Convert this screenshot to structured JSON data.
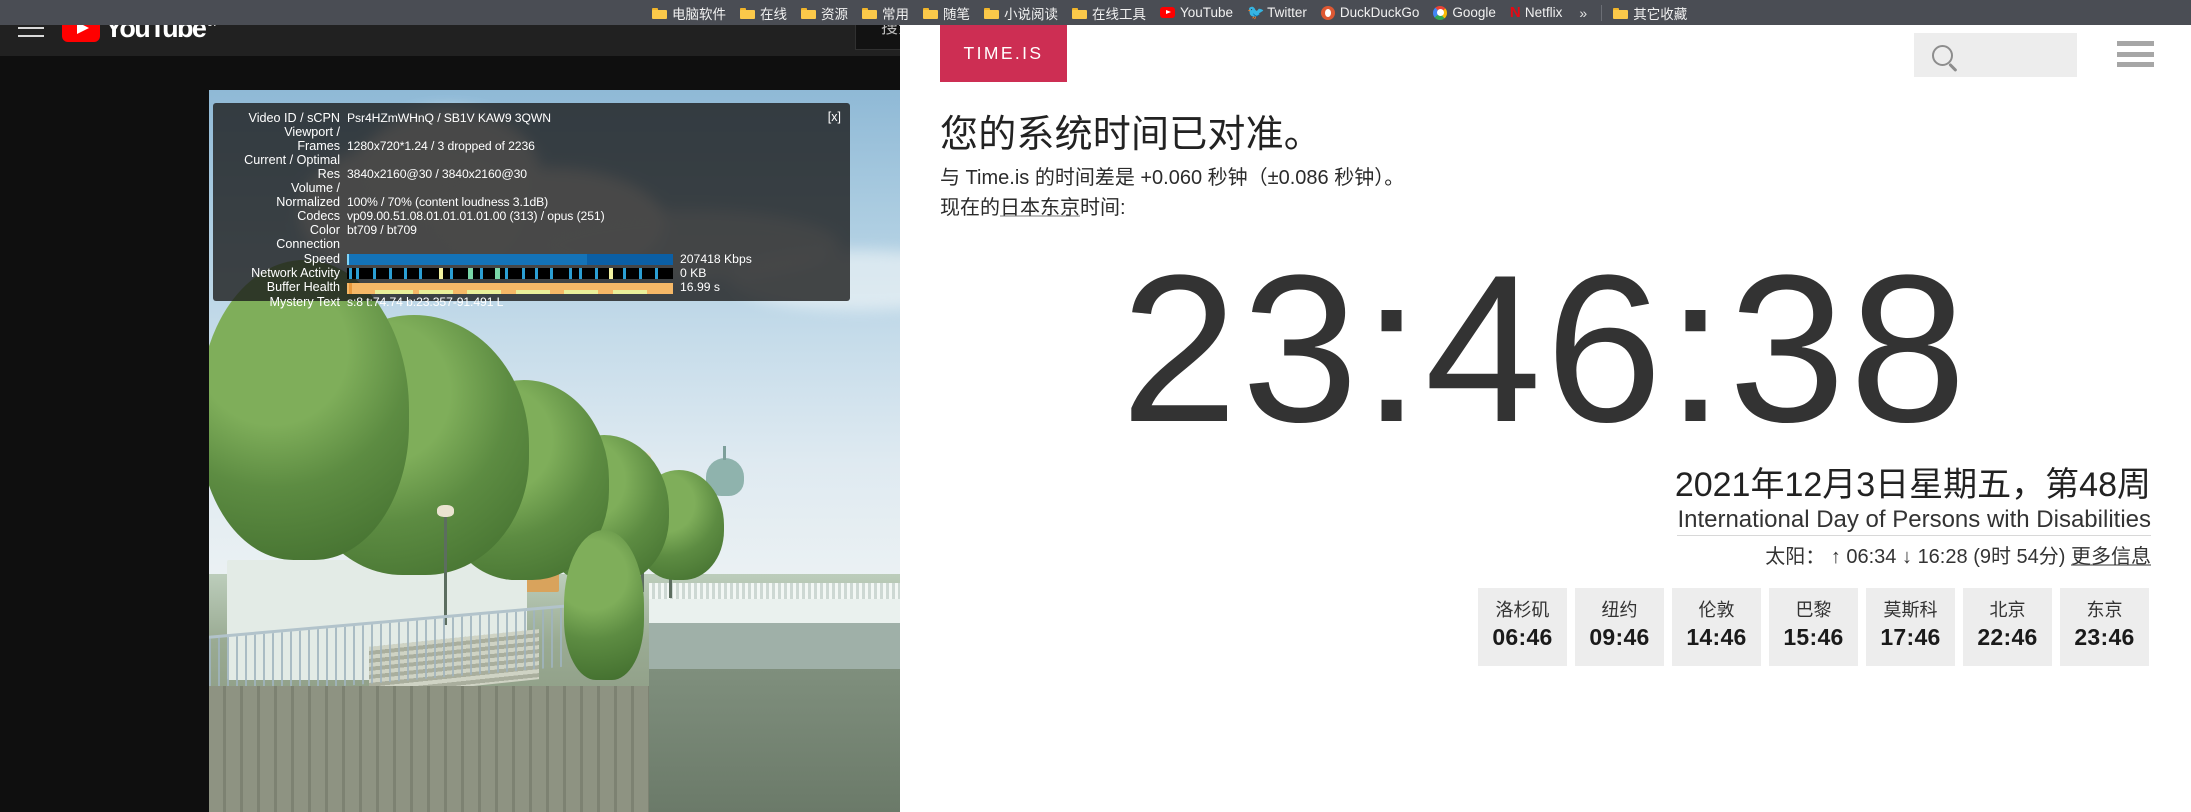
{
  "youtube": {
    "menu_icon": "hamburger-icon",
    "logo_text": "YouTube",
    "country_code": "JP",
    "search_label": "搜索",
    "stats": {
      "close_label": "[x]",
      "rows": [
        {
          "label": "Video ID / sCPN",
          "value": "Psr4HZmWHnQ / SB1V KAW9 3QWN"
        },
        {
          "label": "Viewport /\nFrames",
          "value": "1280x720*1.24 / 3 dropped of 2236"
        },
        {
          "label": "Current / Optimal\nRes",
          "value": "3840x2160@30 / 3840x2160@30"
        },
        {
          "label": "Volume /\nNormalized",
          "value": "100% / 70% (content loudness 3.1dB)"
        },
        {
          "label": "Codecs",
          "value": "vp09.00.51.08.01.01.01.01.00 (313) / opus (251)"
        },
        {
          "label": "Color",
          "value": "bt709 / bt709"
        },
        {
          "label": "Connection",
          "value": ""
        }
      ],
      "bars": [
        {
          "label": "Speed",
          "value": "207418 Kbps"
        },
        {
          "label": "Network Activity",
          "value": "0 KB"
        },
        {
          "label": "Buffer Health",
          "value": "16.99 s"
        }
      ],
      "mystery_label": "Mystery Text",
      "mystery_value": "s:8 t:74.74 b:23.357-91.491 L"
    }
  },
  "bookmarks": [
    {
      "label": "电脑软件",
      "icon": "folder-icon"
    },
    {
      "label": "在线",
      "icon": "folder-icon"
    },
    {
      "label": "资源",
      "icon": "folder-icon"
    },
    {
      "label": "常用",
      "icon": "folder-icon"
    },
    {
      "label": "随笔",
      "icon": "folder-icon"
    },
    {
      "label": "小说阅读",
      "icon": "folder-icon"
    },
    {
      "label": "在线工具",
      "icon": "folder-icon"
    },
    {
      "label": "YouTube",
      "icon": "youtube-icon"
    },
    {
      "label": "Twitter",
      "icon": "twitter-icon"
    },
    {
      "label": "DuckDuckGo",
      "icon": "duckduckgo-icon"
    },
    {
      "label": "Google",
      "icon": "google-icon"
    },
    {
      "label": "Netflix",
      "icon": "netflix-icon"
    }
  ],
  "bookmark_overflow": "»",
  "other_bookmarks": {
    "label": "其它收藏",
    "icon": "folder-icon"
  },
  "timeis": {
    "logo": "TIME.IS",
    "search_placeholder": "",
    "menu_icon": "hamburger-icon",
    "headline": "您的系统时间已对准。",
    "offset_line": "与 Time.is 的时间差是 +0.060 秒钟（±0.086 秒钟）。",
    "now_prefix": "现在的",
    "now_location": "日本东京",
    "now_suffix": "时间:",
    "clock": "23:46:38",
    "date_line": "2021年12月3日星期五，第48周",
    "holiday": "International Day of Persons with Disabilities",
    "sun_label": "太阳：",
    "sun_rise_icon": "↑",
    "sun_rise": "06:34",
    "sun_set_icon": "↓",
    "sun_set": "16:28",
    "day_length": "(9时 54分)",
    "more_info": "更多信息",
    "cities": [
      {
        "name": "洛杉矶",
        "time": "06:46"
      },
      {
        "name": "纽约",
        "time": "09:46"
      },
      {
        "name": "伦敦",
        "time": "14:46"
      },
      {
        "name": "巴黎",
        "time": "15:46"
      },
      {
        "name": "莫斯科",
        "time": "17:46"
      },
      {
        "name": "北京",
        "time": "22:46"
      },
      {
        "name": "东京",
        "time": "23:46"
      }
    ]
  },
  "colors": {
    "timeis_brand": "#cd2e53",
    "youtube_red": "#ff0000",
    "bookmark_bar": "#4a4d54",
    "youtube_dark": "#212121"
  }
}
